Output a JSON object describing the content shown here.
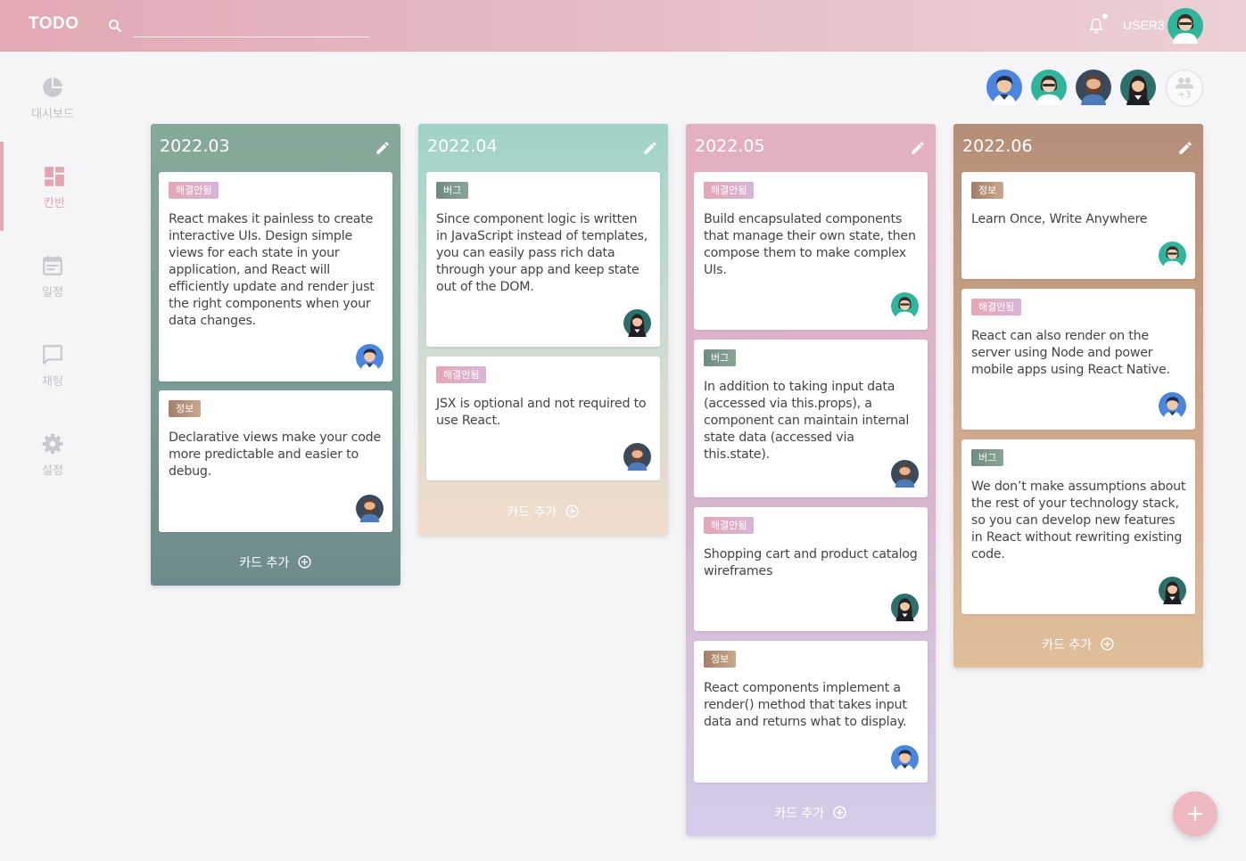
{
  "header": {
    "logo": "TODO",
    "search_placeholder": "",
    "username": "USER3"
  },
  "sidebar": {
    "items": [
      {
        "label": "대시보드",
        "icon": "pie-chart-icon"
      },
      {
        "label": "칸반",
        "icon": "kanban-icon",
        "active": true
      },
      {
        "label": "일정",
        "icon": "calendar-icon"
      },
      {
        "label": "채팅",
        "icon": "chat-icon"
      },
      {
        "label": "설정",
        "icon": "gear-icon"
      }
    ]
  },
  "team": {
    "more_count": "+3"
  },
  "add_card_label": "카드 추가",
  "columns": [
    {
      "title": "2022.03",
      "cards": [
        {
          "tag": "해결안됨",
          "text": "React makes it painless to create interactive UIs. Design simple views for each state in your application, and React will efficiently update and render just the right components when your data changes."
        },
        {
          "tag": "정보",
          "text": "Declarative views make your code more predictable and easier to debug."
        }
      ]
    },
    {
      "title": "2022.04",
      "cards": [
        {
          "tag": "버그",
          "text": "Since component logic is written in JavaScript instead of templates, you can easily pass rich data through your app and keep state out of the DOM."
        },
        {
          "tag": "해결안됨",
          "text": "JSX is optional and not required to use React."
        }
      ]
    },
    {
      "title": "2022.05",
      "cards": [
        {
          "tag": "해결안됨",
          "text": "Build encapsulated components that manage their own state, then compose them to make complex UIs."
        },
        {
          "tag": "버그",
          "text": "In addition to taking input data (accessed via this.props), a component can maintain internal state data (accessed via this.state)."
        },
        {
          "tag": "해결안됨",
          "text": "Shopping cart and product catalog wireframes"
        },
        {
          "tag": "정보",
          "text": "React components implement a render() method that takes input data and returns what to display."
        }
      ]
    },
    {
      "title": "2022.06",
      "cards": [
        {
          "tag": "정보",
          "text": "Learn Once, Write Anywhere"
        },
        {
          "tag": "해결안됨",
          "text": "React can also render on the server using Node and power mobile apps using React Native."
        },
        {
          "tag": "버그",
          "text": "We don’t make assumptions about the rest of your technology stack, so you can develop new features in React without rewriting existing code."
        }
      ]
    }
  ],
  "colors": {
    "header_start": "#e1a9b4",
    "accent_pink": "#e3a5b2",
    "fab": "#eeb9c0"
  }
}
